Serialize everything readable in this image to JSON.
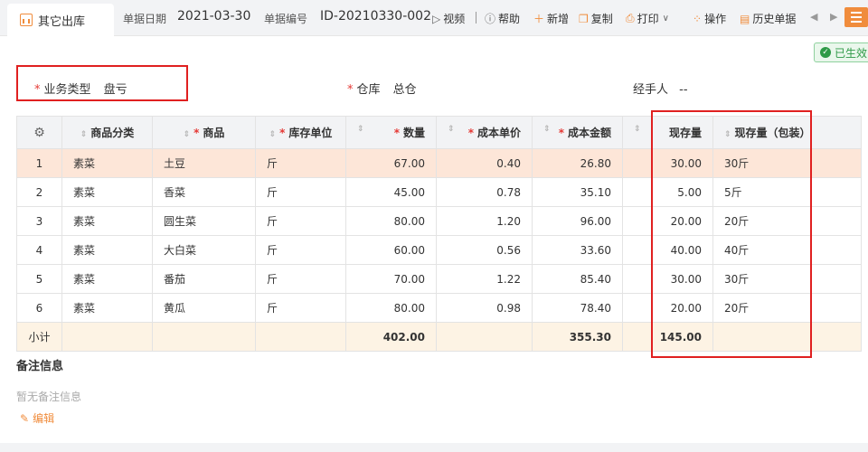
{
  "header": {
    "tab_label": "其它出库",
    "date_label": "单据日期",
    "date_value": "2021-03-30",
    "no_label": "单据编号",
    "no_value": "ID-20210330-002",
    "video_label": "视频",
    "help_label": "帮助"
  },
  "toolbar": {
    "new_label": "新增",
    "copy_label": "复制",
    "print_label": "打印",
    "ops_label": "操作",
    "history_label": "历史单据"
  },
  "status": {
    "label": "已生效",
    "color": "#2e9a47"
  },
  "form": {
    "biz_type_label": "业务类型",
    "biz_type_value": "盘亏",
    "warehouse_label": "仓库",
    "warehouse_value": "总仓",
    "handler_label": "经手人",
    "handler_value": "--"
  },
  "table": {
    "columns": [
      "商品分类",
      "商品",
      "库存单位",
      "数量",
      "成本单价",
      "成本金额",
      "现存量",
      "现存量（包装）"
    ],
    "rows": [
      {
        "no": "1",
        "category": "素菜",
        "product": "土豆",
        "unit": "斤",
        "qty": "67.00",
        "price": "0.40",
        "amount": "26.80",
        "stock": "30.00",
        "stock_pkg": "30斤"
      },
      {
        "no": "2",
        "category": "素菜",
        "product": "香菜",
        "unit": "斤",
        "qty": "45.00",
        "price": "0.78",
        "amount": "35.10",
        "stock": "5.00",
        "stock_pkg": "5斤"
      },
      {
        "no": "3",
        "category": "素菜",
        "product": "圆生菜",
        "unit": "斤",
        "qty": "80.00",
        "price": "1.20",
        "amount": "96.00",
        "stock": "20.00",
        "stock_pkg": "20斤"
      },
      {
        "no": "4",
        "category": "素菜",
        "product": "大白菜",
        "unit": "斤",
        "qty": "60.00",
        "price": "0.56",
        "amount": "33.60",
        "stock": "40.00",
        "stock_pkg": "40斤"
      },
      {
        "no": "5",
        "category": "素菜",
        "product": "番茄",
        "unit": "斤",
        "qty": "70.00",
        "price": "1.22",
        "amount": "85.40",
        "stock": "30.00",
        "stock_pkg": "30斤"
      },
      {
        "no": "6",
        "category": "素菜",
        "product": "黄瓜",
        "unit": "斤",
        "qty": "80.00",
        "price": "0.98",
        "amount": "78.40",
        "stock": "20.00",
        "stock_pkg": "20斤"
      }
    ],
    "subtotal": {
      "label": "小计",
      "qty": "402.00",
      "amount": "355.30",
      "stock": "145.00"
    }
  },
  "remarks": {
    "title": "备注信息",
    "empty_text": "暂无备注信息",
    "edit_label": "编辑"
  },
  "colors": {
    "accent": "#f08c3c",
    "highlight_row": "#fde6d8",
    "subtotal_row": "#fdf3e4",
    "annotation_box": "#e02020"
  }
}
